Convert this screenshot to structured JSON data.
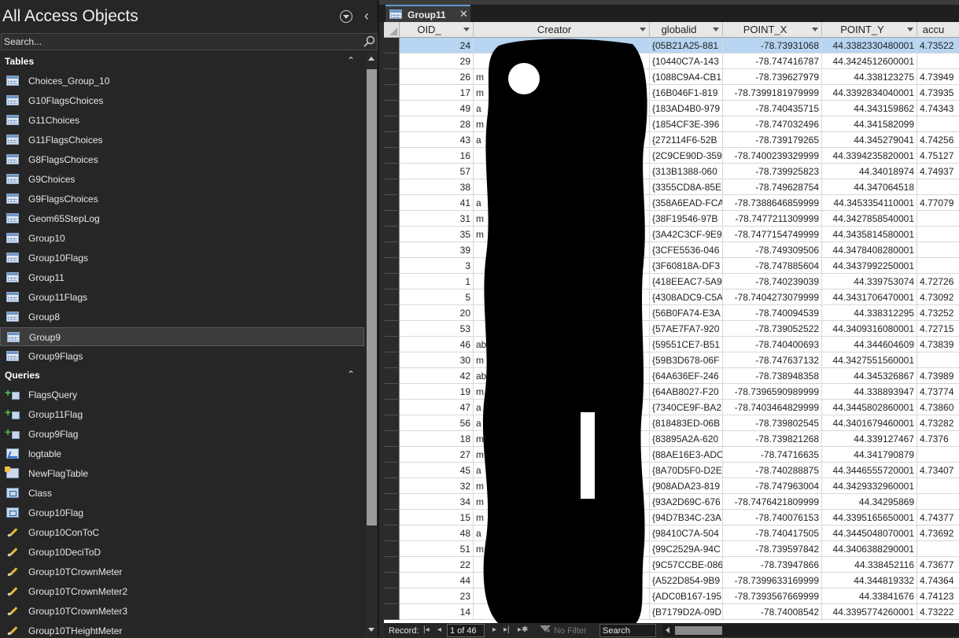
{
  "nav": {
    "title": "All Access Objects",
    "search_placeholder": "Search...",
    "groups": [
      {
        "label": "Tables",
        "items": [
          {
            "label": "Choices_Group_10",
            "icon": "table-icon"
          },
          {
            "label": "G10FlagsChoices",
            "icon": "table-icon"
          },
          {
            "label": "G11Choices",
            "icon": "table-icon"
          },
          {
            "label": "G11FlagsChoices",
            "icon": "table-icon"
          },
          {
            "label": "G8FlagsChoices",
            "icon": "table-icon"
          },
          {
            "label": "G9Choices",
            "icon": "table-icon"
          },
          {
            "label": "G9FlagsChoices",
            "icon": "table-icon"
          },
          {
            "label": "Geom65StepLog",
            "icon": "table-icon"
          },
          {
            "label": "Group10",
            "icon": "table-icon"
          },
          {
            "label": "Group10Flags",
            "icon": "table-icon"
          },
          {
            "label": "Group11",
            "icon": "table-icon"
          },
          {
            "label": "Group11Flags",
            "icon": "table-icon"
          },
          {
            "label": "Group8",
            "icon": "table-icon"
          },
          {
            "label": "Group9",
            "icon": "table-icon",
            "selected": true
          },
          {
            "label": "Group9Flags",
            "icon": "table-icon"
          }
        ]
      },
      {
        "label": "Queries",
        "items": [
          {
            "label": "FlagsQuery",
            "icon": "append-query-icon"
          },
          {
            "label": "Group11Flag",
            "icon": "append-query-icon"
          },
          {
            "label": "Group9Flag",
            "icon": "append-query-icon"
          },
          {
            "label": "logtable",
            "icon": "select-query-icon"
          },
          {
            "label": "NewFlagTable",
            "icon": "make-table-query-icon"
          },
          {
            "label": "Class",
            "icon": "union-query-icon"
          },
          {
            "label": "Group10Flag",
            "icon": "union-query-icon"
          },
          {
            "label": "Group10ConToC",
            "icon": "update-query-icon"
          },
          {
            "label": "Group10DeciToD",
            "icon": "update-query-icon"
          },
          {
            "label": "Group10TCrownMeter",
            "icon": "update-query-icon"
          },
          {
            "label": "Group10TCrownMeter2",
            "icon": "update-query-icon"
          },
          {
            "label": "Group10TCrownMeter3",
            "icon": "update-query-icon"
          },
          {
            "label": "Group10THeightMeter",
            "icon": "update-query-icon"
          }
        ]
      }
    ]
  },
  "tab": {
    "label": "Group11"
  },
  "grid": {
    "columns": [
      "OID_",
      "Creator",
      "globalid",
      "POINT_X",
      "POINT_Y",
      "accu"
    ],
    "rows": [
      {
        "oid": "24",
        "creator": "",
        "globalid": "{05B21A25-881",
        "x": "-78.73931068",
        "y": "44.3382330480001",
        "acc": "4.73522"
      },
      {
        "oid": "29",
        "creator": "",
        "globalid": "{10440C7A-143",
        "x": "-78.747416787",
        "y": "44.3424512600001",
        "acc": ""
      },
      {
        "oid": "26",
        "creator": "m",
        "globalid": "{1088C9A4-CB1",
        "x": "-78.739627979",
        "y": "44.338123275",
        "acc": "4.73949"
      },
      {
        "oid": "17",
        "creator": "m",
        "globalid": "{16B046F1-819",
        "x": "-78.7399181979999",
        "y": "44.3392834040001",
        "acc": "4.73935"
      },
      {
        "oid": "49",
        "creator": "a",
        "globalid": "{183AD4B0-979",
        "x": "-78.740435715",
        "y": "44.343159862",
        "acc": "4.74343"
      },
      {
        "oid": "28",
        "creator": "m",
        "globalid": "{1854CF3E-396",
        "x": "-78.747032496",
        "y": "44.341582099",
        "acc": ""
      },
      {
        "oid": "43",
        "creator": "a",
        "globalid": "{272114F6-52B",
        "x": "-78.739179265",
        "y": "44.345279041",
        "acc": "4.74256"
      },
      {
        "oid": "16",
        "creator": "",
        "globalid": "{2C9CE90D-359",
        "x": "-78.7400239329999",
        "y": "44.3394235820001",
        "acc": "4.75127"
      },
      {
        "oid": "57",
        "creator": "",
        "globalid": "{313B1388-060",
        "x": "-78.739925823",
        "y": "44.34018974",
        "acc": "4.74937"
      },
      {
        "oid": "38",
        "creator": "",
        "globalid": "{3355CD8A-85E",
        "x": "-78.749628754",
        "y": "44.347064518",
        "acc": ""
      },
      {
        "oid": "41",
        "creator": "a",
        "globalid": "{358A6EAD-FCA",
        "x": "-78.7388646859999",
        "y": "44.3453354110001",
        "acc": "4.77079"
      },
      {
        "oid": "31",
        "creator": "m",
        "globalid": "{38F19546-97B",
        "x": "-78.7477211309999",
        "y": "44.3427858540001",
        "acc": ""
      },
      {
        "oid": "35",
        "creator": "m",
        "globalid": "{3A42C3CF-9E9",
        "x": "-78.7477154749999",
        "y": "44.3435814580001",
        "acc": ""
      },
      {
        "oid": "39",
        "creator": "",
        "globalid": "{3CFE5536-046",
        "x": "-78.749309506",
        "y": "44.3478408280001",
        "acc": ""
      },
      {
        "oid": "3",
        "creator": "",
        "globalid": "{3F60818A-DF3",
        "x": "-78.747885604",
        "y": "44.3437992250001",
        "acc": ""
      },
      {
        "oid": "1",
        "creator": "",
        "globalid": "{418EEAC7-5A9",
        "x": "-78.740239039",
        "y": "44.339753074",
        "acc": "4.72726"
      },
      {
        "oid": "5",
        "creator": "",
        "globalid": "{4308ADC9-C5A",
        "x": "-78.7404273079999",
        "y": "44.3431706470001",
        "acc": "4.73092"
      },
      {
        "oid": "20",
        "creator": "",
        "globalid": "{56B0FA74-E3A",
        "x": "-78.740094539",
        "y": "44.338312295",
        "acc": "4.73252"
      },
      {
        "oid": "53",
        "creator": "",
        "globalid": "{57AE7FA7-920",
        "x": "-78.739052522",
        "y": "44.3409316080001",
        "acc": "4.72715"
      },
      {
        "oid": "46",
        "creator": "ab",
        "globalid": "{59551CE7-B51",
        "x": "-78.740400693",
        "y": "44.344604609",
        "acc": "4.73839"
      },
      {
        "oid": "30",
        "creator": "m",
        "globalid": "{59B3D678-06F",
        "x": "-78.747637132",
        "y": "44.3427551560001",
        "acc": ""
      },
      {
        "oid": "42",
        "creator": "ab",
        "globalid": "{64A636EF-246",
        "x": "-78.738948358",
        "y": "44.345326867",
        "acc": "4.73989"
      },
      {
        "oid": "19",
        "creator": "m",
        "globalid": "{64AB8027-F20",
        "x": "-78.7396590989999",
        "y": "44.338893947",
        "acc": "4.73774"
      },
      {
        "oid": "47",
        "creator": "a",
        "globalid": "{7340CE9F-BA2",
        "x": "-78.7403464829999",
        "y": "44.3445802860001",
        "acc": "4.73860"
      },
      {
        "oid": "56",
        "creator": "a",
        "globalid": "{818483ED-06B",
        "x": "-78.739802545",
        "y": "44.3401679460001",
        "acc": "4.73282"
      },
      {
        "oid": "18",
        "creator": "m",
        "globalid": "{83895A2A-620",
        "x": "-78.739821268",
        "y": "44.339127467",
        "acc": "4.7376"
      },
      {
        "oid": "27",
        "creator": "m",
        "globalid": "{88AE16E3-ADC",
        "x": "-78.74716635",
        "y": "44.341790879",
        "acc": ""
      },
      {
        "oid": "45",
        "creator": "a",
        "globalid": "{8A70D5F0-D2E",
        "x": "-78.740288875",
        "y": "44.3446555720001",
        "acc": "4.73407"
      },
      {
        "oid": "32",
        "creator": "m",
        "globalid": "{908ADA23-819",
        "x": "-78.747963004",
        "y": "44.3429332960001",
        "acc": ""
      },
      {
        "oid": "34",
        "creator": "m",
        "globalid": "{93A2D69C-676",
        "x": "-78.7476421809999",
        "y": "44.34295869",
        "acc": ""
      },
      {
        "oid": "15",
        "creator": "m",
        "globalid": "{94D7B34C-23A",
        "x": "-78.740076153",
        "y": "44.3395165650001",
        "acc": "4.74377"
      },
      {
        "oid": "48",
        "creator": "a",
        "globalid": "{98410C7A-504",
        "x": "-78.740417505",
        "y": "44.3445048070001",
        "acc": "4.73692"
      },
      {
        "oid": "51",
        "creator": "m",
        "globalid": "{99C2529A-94C",
        "x": "-78.739597842",
        "y": "44.3406388290001",
        "acc": ""
      },
      {
        "oid": "22",
        "creator": "",
        "globalid": "{9C57CCBE-086",
        "x": "-78.73947866",
        "y": "44.338452116",
        "acc": "4.73677"
      },
      {
        "oid": "44",
        "creator": "",
        "globalid": "{A522D854-9B9",
        "x": "-78.7399633169999",
        "y": "44.344819332",
        "acc": "4.74364"
      },
      {
        "oid": "23",
        "creator": "",
        "globalid": "{ADC0B167-195",
        "x": "-78.7393567669999",
        "y": "44.33841676",
        "acc": "4.74123"
      },
      {
        "oid": "14",
        "creator": "",
        "globalid": "{B7179D2A-09D",
        "x": "-78.74008542",
        "y": "44.3395774260001",
        "acc": "4.73222"
      }
    ]
  },
  "record_nav": {
    "label": "Record:",
    "position": "1 of 46",
    "filter_label": "No Filter",
    "search_placeholder": "Search"
  }
}
